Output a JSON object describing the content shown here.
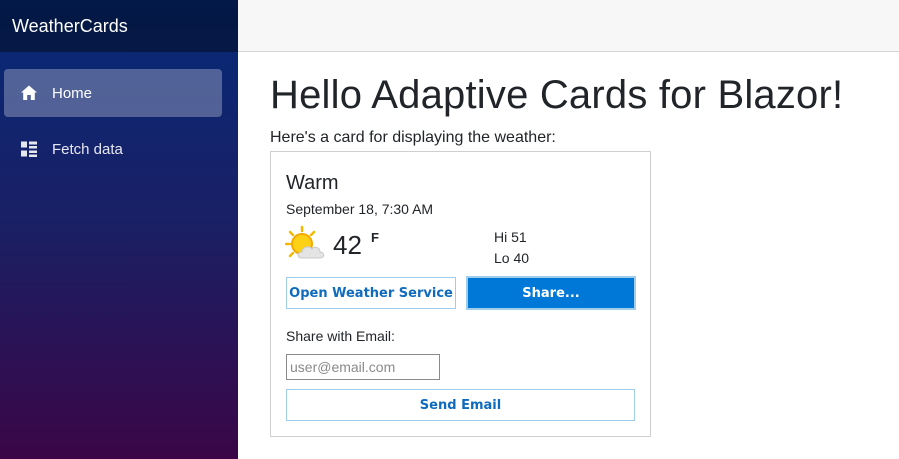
{
  "sidebar": {
    "brand": "WeatherCards",
    "items": [
      {
        "label": "Home",
        "icon": "home-icon",
        "active": true
      },
      {
        "label": "Fetch data",
        "icon": "list-icon",
        "active": false
      }
    ]
  },
  "main": {
    "title": "Hello Adaptive Cards for Blazor!",
    "intro": "Here's a card for displaying the weather:"
  },
  "card": {
    "title": "Warm",
    "date": "September 18, 7:30 AM",
    "weather_icon": "partly-sunny-icon",
    "temperature": "42",
    "unit": "F",
    "hi": "Hi 51",
    "lo": "Lo 40",
    "open_button": "Open Weather Service",
    "share_button": "Share...",
    "share_label": "Share with Email:",
    "email_placeholder": "user@email.com",
    "send_button": "Send Email"
  },
  "colors": {
    "accent": "#0078d7",
    "link": "#0f6cbd",
    "sidebar_top": "#062a78",
    "sidebar_bottom": "#3a0647"
  }
}
